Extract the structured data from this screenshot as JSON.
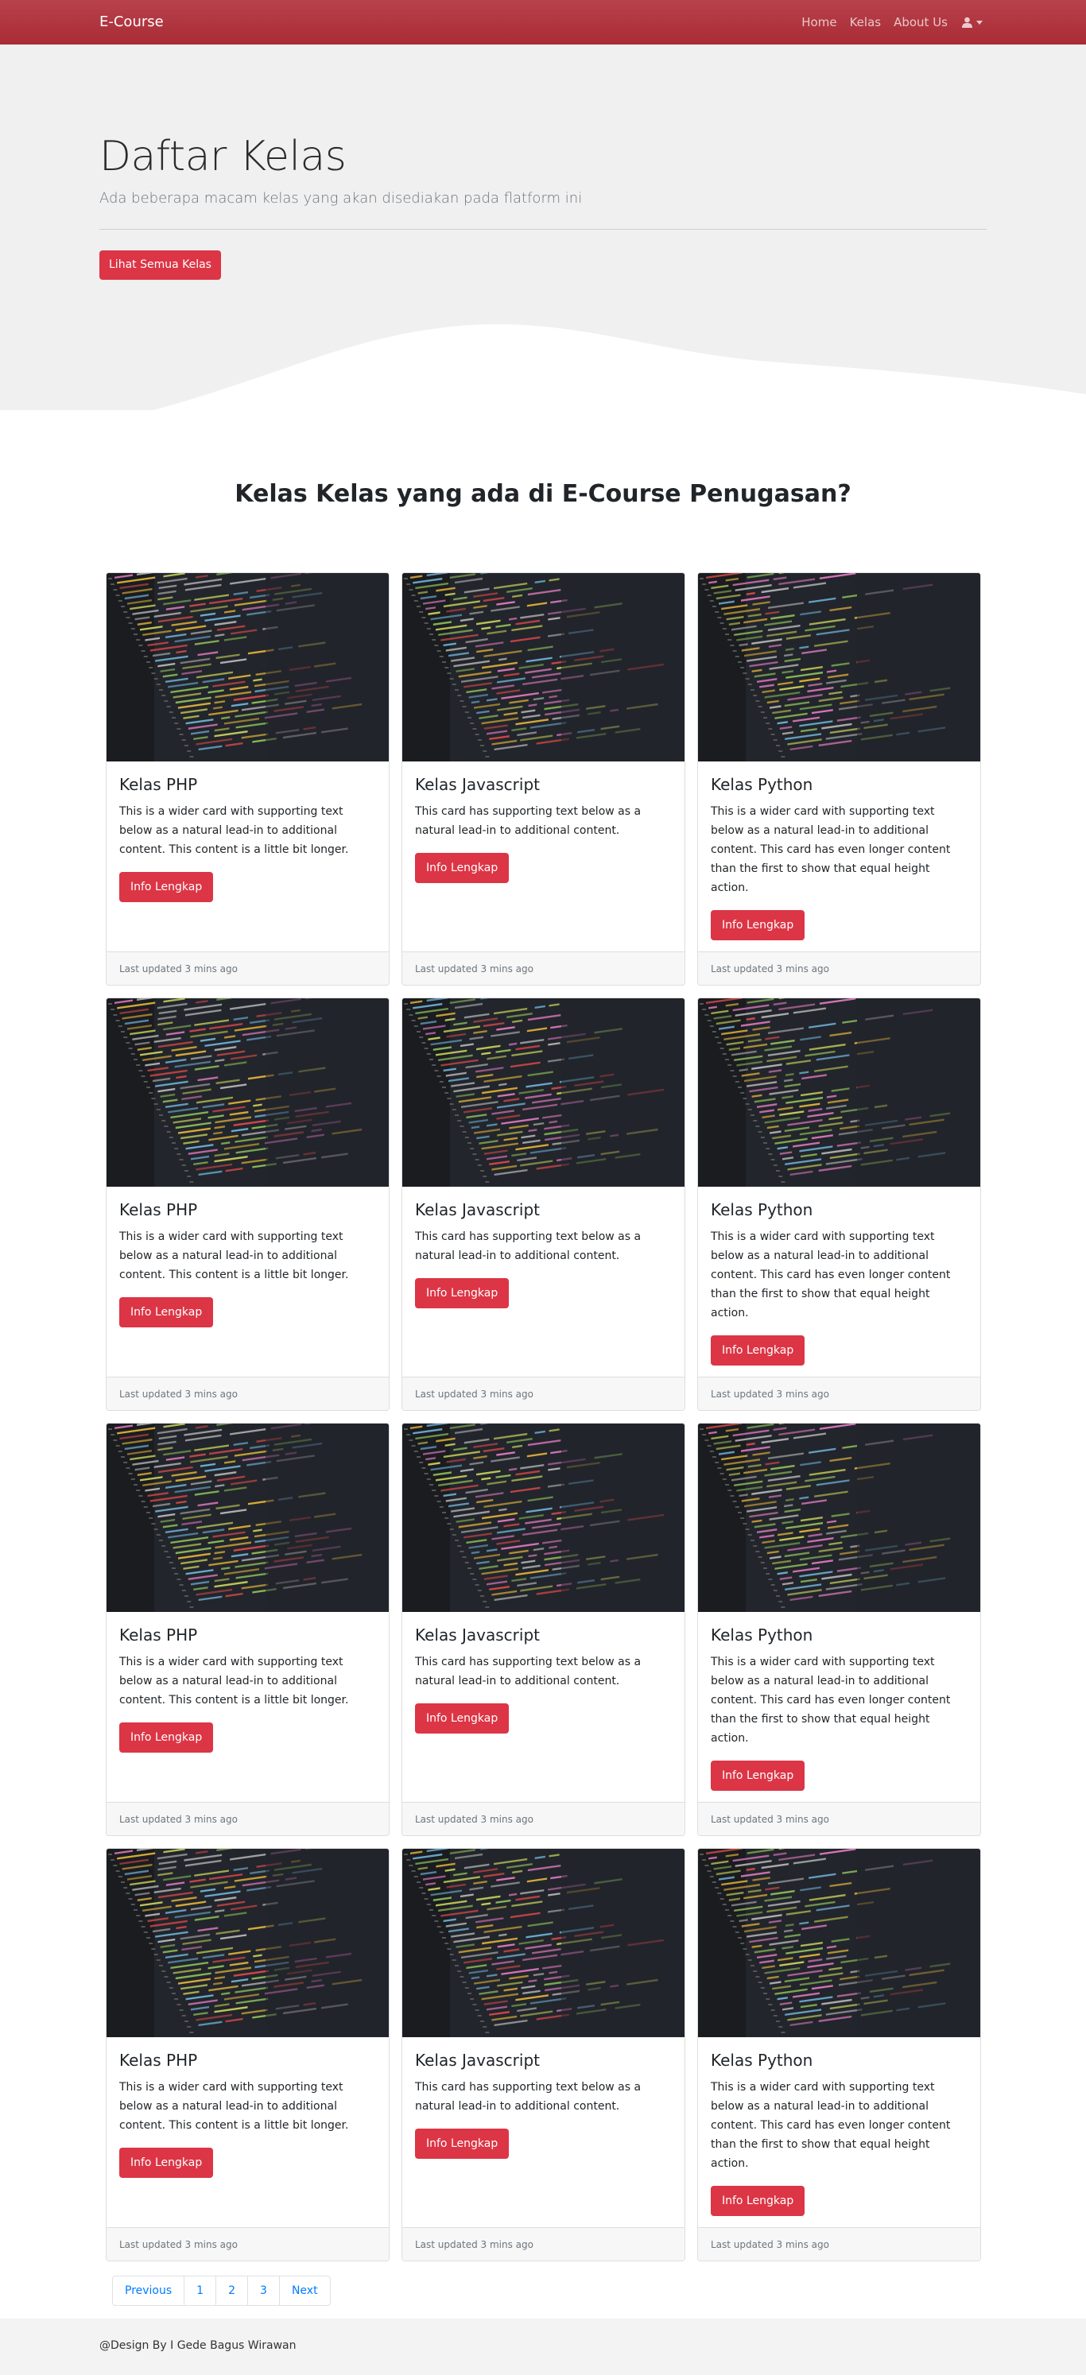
{
  "navbar": {
    "brand": "E-Course",
    "links": [
      "Home",
      "Kelas",
      "About Us"
    ],
    "user_icon": "user-icon"
  },
  "jumbotron": {
    "title": "Daftar Kelas",
    "lead": "Ada beberapa macam kelas yang akan disediakan pada flatform ini",
    "button": "Lihat Semua Kelas"
  },
  "section": {
    "title": "Kelas Kelas yang ada di E-Course Penugasan?"
  },
  "cards": [
    {
      "title": "Kelas PHP",
      "text": "This is a wider card with supporting text below as a natural lead-in to additional content. This content is a little bit longer.",
      "button": "Info Lengkap",
      "footer": "Last updated 3 mins ago"
    },
    {
      "title": "Kelas Javascript",
      "text": "This card has supporting text below as a natural lead-in to additional content.",
      "button": "Info Lengkap",
      "footer": "Last updated 3 mins ago"
    },
    {
      "title": "Kelas Python",
      "text": "This is a wider card with supporting text below as a natural lead-in to additional content. This card has even longer content than the first to show that equal height action.",
      "button": "Info Lengkap",
      "footer": "Last updated 3 mins ago"
    },
    {
      "title": "Kelas PHP",
      "text": "This is a wider card with supporting text below as a natural lead-in to additional content. This content is a little bit longer.",
      "button": "Info Lengkap",
      "footer": "Last updated 3 mins ago"
    },
    {
      "title": "Kelas Javascript",
      "text": "This card has supporting text below as a natural lead-in to additional content.",
      "button": "Info Lengkap",
      "footer": "Last updated 3 mins ago"
    },
    {
      "title": "Kelas Python",
      "text": "This is a wider card with supporting text below as a natural lead-in to additional content. This card has even longer content than the first to show that equal height action.",
      "button": "Info Lengkap",
      "footer": "Last updated 3 mins ago"
    },
    {
      "title": "Kelas PHP",
      "text": "This is a wider card with supporting text below as a natural lead-in to additional content. This content is a little bit longer.",
      "button": "Info Lengkap",
      "footer": "Last updated 3 mins ago"
    },
    {
      "title": "Kelas Javascript",
      "text": "This card has supporting text below as a natural lead-in to additional content.",
      "button": "Info Lengkap",
      "footer": "Last updated 3 mins ago"
    },
    {
      "title": "Kelas Python",
      "text": "This is a wider card with supporting text below as a natural lead-in to additional content. This card has even longer content than the first to show that equal height action.",
      "button": "Info Lengkap",
      "footer": "Last updated 3 mins ago"
    },
    {
      "title": "Kelas PHP",
      "text": "This is a wider card with supporting text below as a natural lead-in to additional content. This content is a little bit longer.",
      "button": "Info Lengkap",
      "footer": "Last updated 3 mins ago"
    },
    {
      "title": "Kelas Javascript",
      "text": "This card has supporting text below as a natural lead-in to additional content.",
      "button": "Info Lengkap",
      "footer": "Last updated 3 mins ago"
    },
    {
      "title": "Kelas Python",
      "text": "This is a wider card with supporting text below as a natural lead-in to additional content. This card has even longer content than the first to show that equal height action.",
      "button": "Info Lengkap",
      "footer": "Last updated 3 mins ago"
    }
  ],
  "pagination": [
    "Previous",
    "1",
    "2",
    "3",
    "Next"
  ],
  "footer": {
    "text": "@Design By I Gede Bagus Wirawan"
  },
  "colors": {
    "navbar": "#a92b35",
    "accent": "#dc3545",
    "link": "#007bff"
  }
}
